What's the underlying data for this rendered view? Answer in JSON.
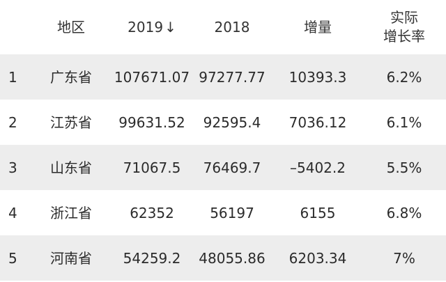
{
  "header": {
    "region": "地区",
    "y2019": "2019",
    "sort_arrow": "↓",
    "y2018": "2018",
    "increase": "增量",
    "rate_line1": "实际",
    "rate_line2": "增长率"
  },
  "rows": [
    {
      "rank": "1",
      "region": "广东省",
      "y2019": "107671.07",
      "y2018": "97277.77",
      "increase": "10393.3",
      "rate": "6.2%"
    },
    {
      "rank": "2",
      "region": "江苏省",
      "y2019": "99631.52",
      "y2018": "92595.4",
      "increase": "7036.12",
      "rate": "6.1%"
    },
    {
      "rank": "3",
      "region": "山东省",
      "y2019": "71067.5",
      "y2018": "76469.7",
      "increase": "–5402.2",
      "rate": "5.5%"
    },
    {
      "rank": "4",
      "region": "浙江省",
      "y2019": "62352",
      "y2018": "56197",
      "increase": "6155",
      "rate": "6.8%"
    },
    {
      "rank": "5",
      "region": "河南省",
      "y2019": "54259.2",
      "y2018": "48055.86",
      "increase": "6203.34",
      "rate": "7%"
    }
  ]
}
